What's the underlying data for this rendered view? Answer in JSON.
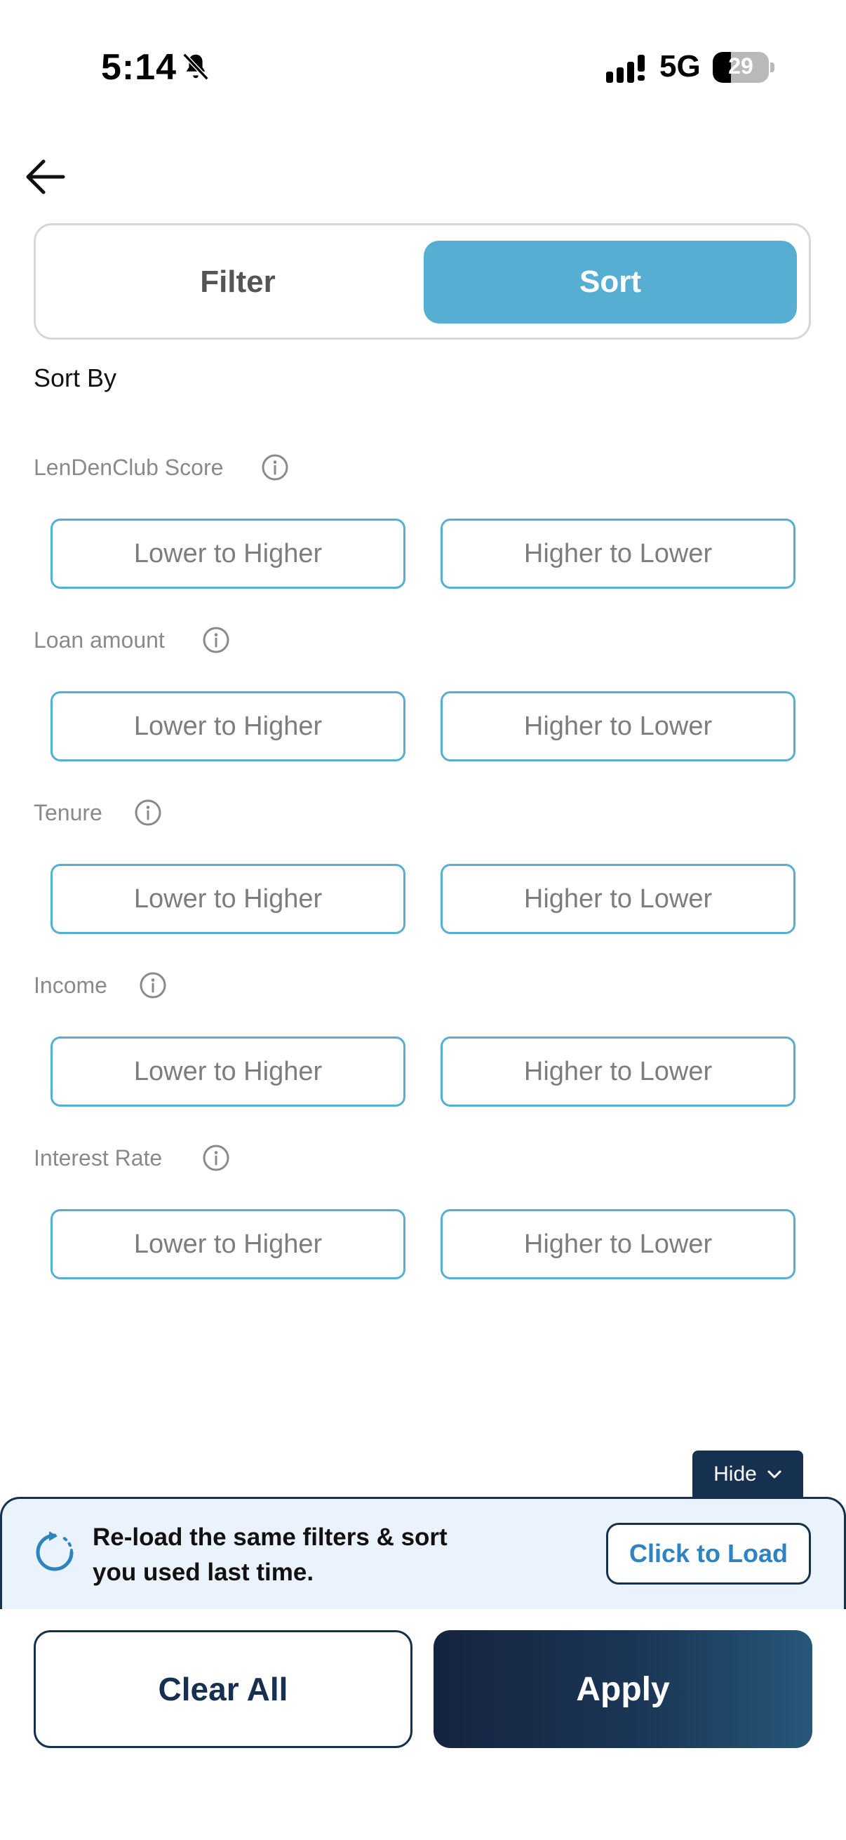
{
  "status_bar": {
    "time": "5:14",
    "network": "5G",
    "battery": "29"
  },
  "tabs": {
    "filter_label": "Filter",
    "sort_label": "Sort",
    "active": "Sort"
  },
  "sort_by_label": "Sort By",
  "sections": [
    {
      "label": "LenDenClub Score",
      "options": [
        "Lower to Higher",
        "Higher to Lower"
      ]
    },
    {
      "label": "Loan amount",
      "options": [
        "Lower to Higher",
        "Higher to Lower"
      ]
    },
    {
      "label": "Tenure",
      "options": [
        "Lower to Higher",
        "Higher to Lower"
      ]
    },
    {
      "label": "Income",
      "options": [
        "Lower to Higher",
        "Higher to Lower"
      ]
    },
    {
      "label": "Interest Rate",
      "options": [
        "Lower to Higher",
        "Higher to Lower"
      ]
    }
  ],
  "reload_banner": {
    "hide_label": "Hide",
    "line1": "Re-load the same filters & sort",
    "line2": "you used last time.",
    "button_label": "Click to Load"
  },
  "footer": {
    "clear_label": "Clear All",
    "apply_label": "Apply"
  },
  "colors": {
    "accent": "#56aed2",
    "navy": "#163150",
    "link": "#2d84c1"
  }
}
